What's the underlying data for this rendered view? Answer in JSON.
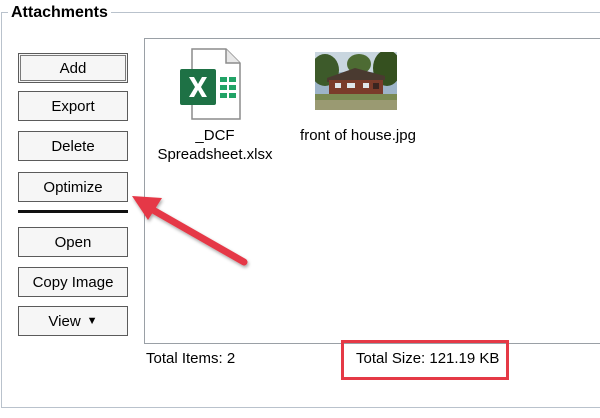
{
  "group": {
    "title": "Attachments"
  },
  "buttons": {
    "add": "Add",
    "export": "Export",
    "delete": "Delete",
    "optimize": "Optimize",
    "open": "Open",
    "copy_image": "Copy Image",
    "view": "View",
    "view_caret": "▼"
  },
  "files": [
    {
      "name_line1": "_DCF",
      "name_line2": "Spreadsheet.xlsx",
      "icon": "excel-file-icon"
    },
    {
      "name": "front of house.jpg",
      "icon": "image-thumbnail"
    }
  ],
  "status": {
    "total_items": "Total Items: 2",
    "total_size": "Total Size: 121.19 KB"
  },
  "colors": {
    "annotation_red": "#e53946",
    "excel_green": "#1e7145"
  }
}
